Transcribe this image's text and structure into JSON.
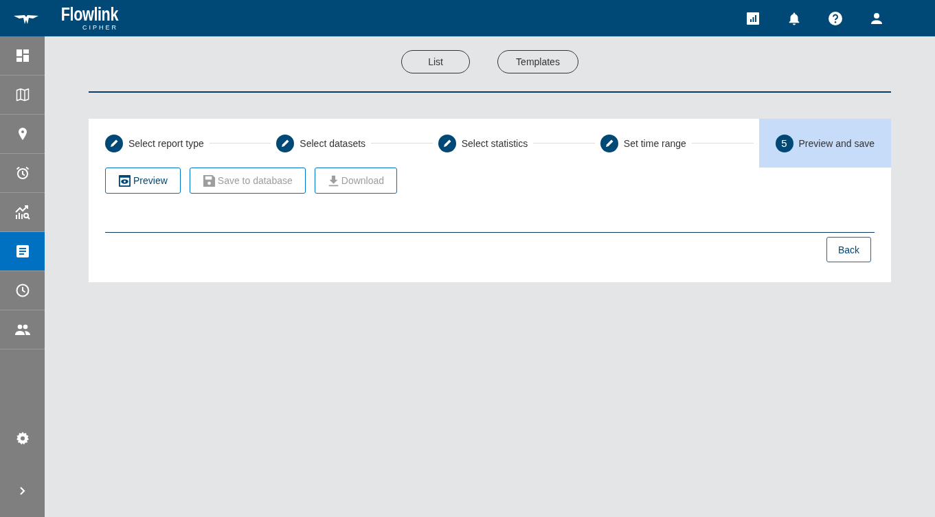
{
  "header": {
    "brand": "Flowlink",
    "subbrand": "CIPHER",
    "actions": [
      {
        "kind": "chart"
      },
      {
        "kind": "bell"
      },
      {
        "kind": "help"
      },
      {
        "kind": "user"
      }
    ]
  },
  "sidebar": {
    "items": [
      {
        "kind": "dashboard",
        "selected": false
      },
      {
        "kind": "map",
        "selected": false
      },
      {
        "kind": "pin",
        "selected": false
      },
      {
        "kind": "alarm",
        "selected": false
      },
      {
        "kind": "analytics",
        "selected": false
      },
      {
        "kind": "report",
        "selected": true
      },
      {
        "kind": "clock",
        "selected": false
      },
      {
        "kind": "people",
        "selected": false
      }
    ],
    "bottom": [
      {
        "kind": "settings"
      },
      {
        "kind": "expand"
      }
    ]
  },
  "view_tabs": [
    {
      "label": "List"
    },
    {
      "label": "Templates"
    }
  ],
  "stepper": {
    "steps": [
      {
        "label": "Select report type",
        "kind": "done"
      },
      {
        "label": "Select datasets",
        "kind": "done"
      },
      {
        "label": "Select statistics",
        "kind": "done"
      },
      {
        "label": "Set time range",
        "kind": "done"
      },
      {
        "label": "Preview and save",
        "kind": "current",
        "number": "5"
      }
    ]
  },
  "actions": [
    {
      "label": "Preview",
      "kind": "preview",
      "disabled": false
    },
    {
      "label": "Save to database",
      "kind": "save",
      "disabled": true
    },
    {
      "label": "Download",
      "kind": "download",
      "disabled": true
    }
  ],
  "back_button": "Back"
}
